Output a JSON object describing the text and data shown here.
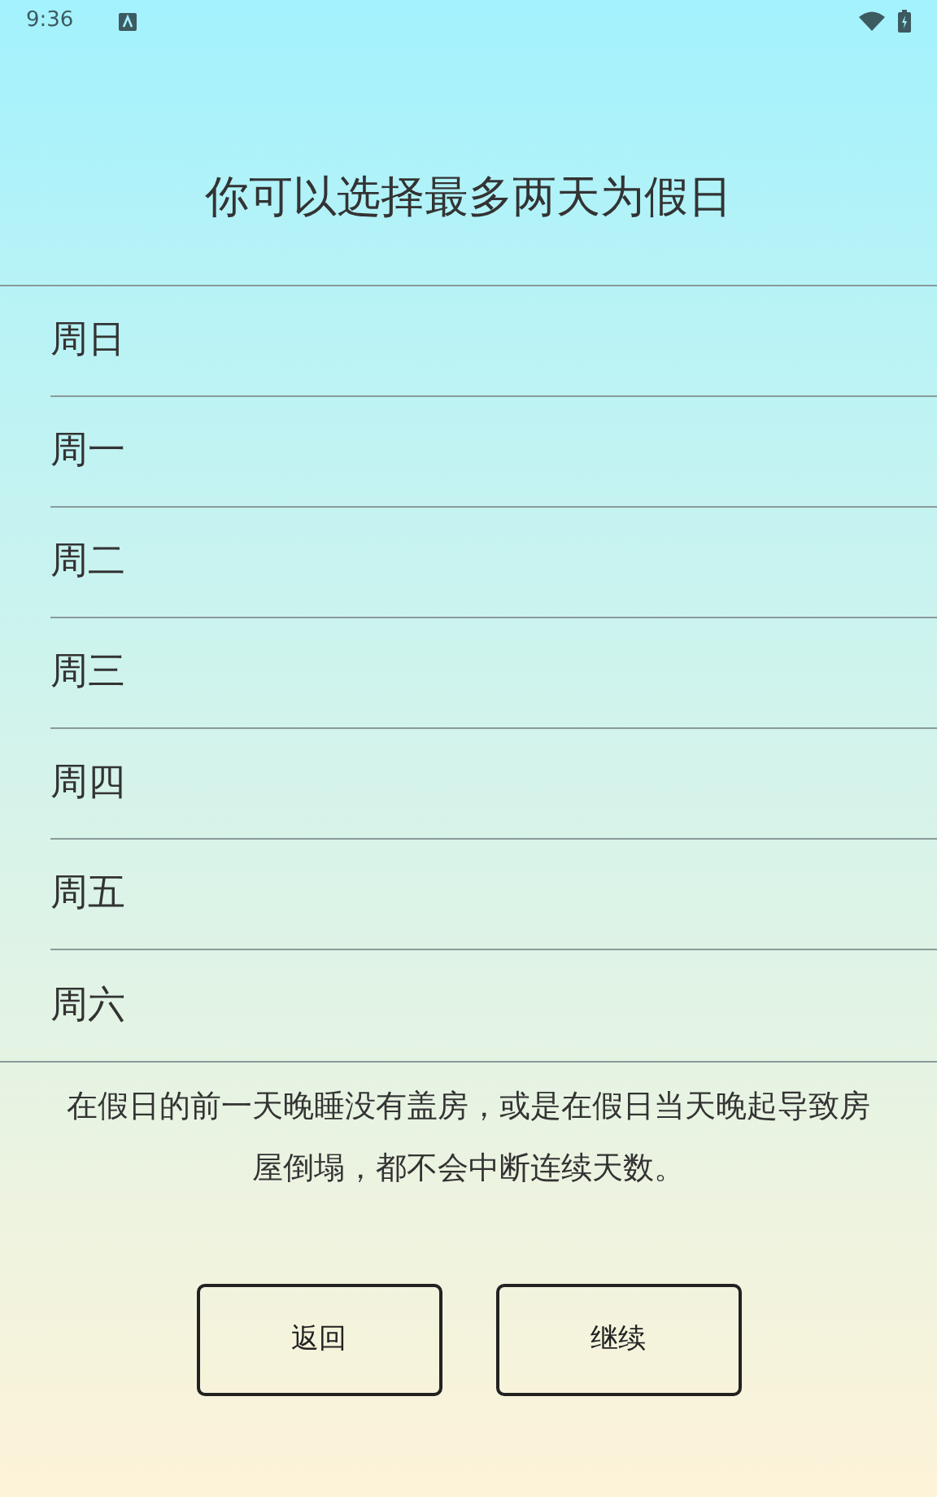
{
  "status_bar": {
    "time": "9:36"
  },
  "title": "你可以选择最多两天为假日",
  "days": [
    {
      "label": "周日",
      "selected": false
    },
    {
      "label": "周一",
      "selected": false
    },
    {
      "label": "周二",
      "selected": false
    },
    {
      "label": "周三",
      "selected": false
    },
    {
      "label": "周四",
      "selected": false
    },
    {
      "label": "周五",
      "selected": false
    },
    {
      "label": "周六",
      "selected": false
    }
  ],
  "note": "在假日的前一天晚睡没有盖房，或是在假日当天晚起导致房屋倒塌，都不会中断连续天数。",
  "buttons": [
    "返回",
    "继续"
  ]
}
